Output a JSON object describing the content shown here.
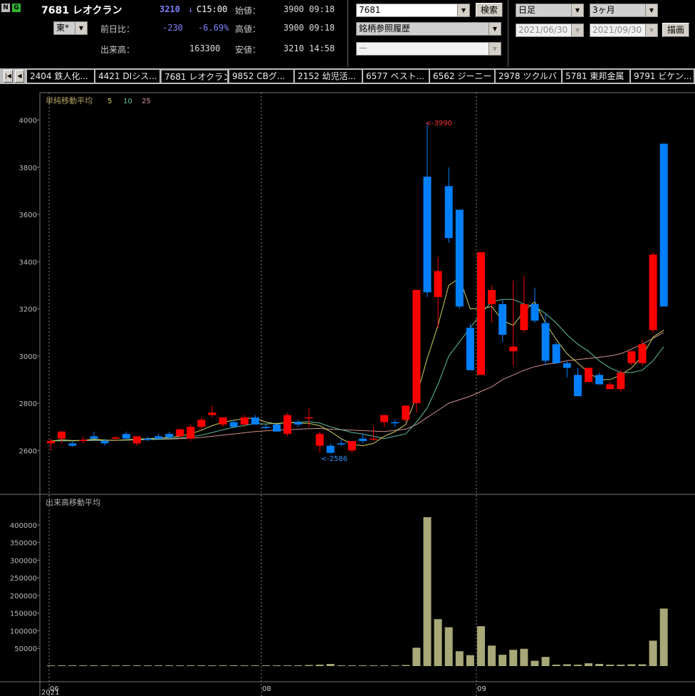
{
  "header": {
    "badge_n": "N",
    "badge_g": "G",
    "stock_title": "7681 レオクラン",
    "current_price": "3210",
    "price_arrow": "↓",
    "price_time": "C15:00",
    "market_select": "東*",
    "change_label": "前日比：",
    "change_value": "-230",
    "change_pct": "-6.69%",
    "volume_label": "出来高：",
    "volume_value": "163300",
    "open_label": "始値：",
    "open_value": "3900",
    "open_time": "09:18",
    "high_label": "高値：",
    "high_value": "3900",
    "high_time": "09:18",
    "low_label": "安値：",
    "low_value": "3210",
    "low_time": "14:58",
    "code_input": "7681",
    "search_button": "検索",
    "history_select": "銘柄参照履歴",
    "blank_select": "ー",
    "period_select": "日足",
    "range_select": "3ヶ月",
    "date_from": "2021/06/30",
    "date_to": "2021/09/30",
    "draw_button": "描画"
  },
  "tabs": [
    "2404 鉄人化...",
    "4421 DIシス...",
    "7681 レオクラン",
    "9852 CBグ...",
    "2152 幼児活...",
    "6577 ベスト...",
    "6562 ジーニー",
    "2978 ツクルバ",
    "5781 東邦金属",
    "9791 ビケン..."
  ],
  "colors": {
    "up": "#ff0000",
    "down": "#0080ff",
    "ma5": "#d0d060",
    "ma10": "#60c0a0",
    "ma25": "#d09090",
    "volume": "#a8a878"
  },
  "chart_data": {
    "type": "candlestick",
    "price_title": "単純移動平均",
    "ma_periods": [
      "5",
      "10",
      "25"
    ],
    "volume_title": "出来高移動平均",
    "price_ylim": [
      2450,
      4080
    ],
    "price_ticks": [
      "4000",
      "3800",
      "3600",
      "3400",
      "3200",
      "3000",
      "2800",
      "2600"
    ],
    "volume_ylim": [
      0,
      440000
    ],
    "volume_ticks": [
      "400000",
      "350000",
      "300000",
      "250000",
      "200000",
      "150000",
      "100000",
      "50000"
    ],
    "x_month_labels": [
      "06",
      "08",
      "09"
    ],
    "x_year_label": "2021",
    "annotations": {
      "high": "<-3990",
      "low": "<-2586"
    },
    "ohlc": [
      [
        2630,
        2650,
        2600,
        2640
      ],
      [
        2650,
        2680,
        2630,
        2680
      ],
      [
        2630,
        2640,
        2615,
        2620
      ],
      [
        2640,
        2660,
        2630,
        2645
      ],
      [
        2660,
        2680,
        2650,
        2650
      ],
      [
        2640,
        2650,
        2620,
        2630
      ],
      [
        2650,
        2660,
        2640,
        2655
      ],
      [
        2670,
        2680,
        2650,
        2650
      ],
      [
        2630,
        2660,
        2620,
        2660
      ],
      [
        2650,
        2660,
        2640,
        2645
      ],
      [
        2660,
        2670,
        2650,
        2650
      ],
      [
        2670,
        2680,
        2650,
        2655
      ],
      [
        2660,
        2690,
        2650,
        2690
      ],
      [
        2650,
        2710,
        2640,
        2700
      ],
      [
        2700,
        2740,
        2690,
        2730
      ],
      [
        2750,
        2790,
        2740,
        2760
      ],
      [
        2710,
        2740,
        2700,
        2740
      ],
      [
        2720,
        2730,
        2700,
        2700
      ],
      [
        2710,
        2750,
        2700,
        2740
      ],
      [
        2740,
        2750,
        2710,
        2710
      ],
      [
        2700,
        2710,
        2690,
        2695
      ],
      [
        2710,
        2710,
        2680,
        2680
      ],
      [
        2670,
        2760,
        2660,
        2750
      ],
      [
        2720,
        2730,
        2700,
        2710
      ],
      [
        2740,
        2780,
        2700,
        2740
      ],
      [
        2620,
        2680,
        2590,
        2670
      ],
      [
        2620,
        2630,
        2586,
        2590
      ],
      [
        2630,
        2650,
        2620,
        2625
      ],
      [
        2600,
        2640,
        2590,
        2640
      ],
      [
        2650,
        2670,
        2630,
        2640
      ],
      [
        2650,
        2700,
        2640,
        2650
      ],
      [
        2720,
        2740,
        2700,
        2750
      ],
      [
        2720,
        2730,
        2700,
        2715
      ],
      [
        2730,
        2790,
        2720,
        2790
      ],
      [
        2800,
        3280,
        2760,
        3280
      ],
      [
        3760,
        3990,
        3250,
        3270
      ],
      [
        3250,
        3420,
        3120,
        3360
      ],
      [
        3720,
        3800,
        3480,
        3500
      ],
      [
        3620,
        3620,
        3200,
        3210
      ],
      [
        3120,
        3140,
        2940,
        2940
      ],
      [
        2920,
        3440,
        2920,
        3440
      ],
      [
        3220,
        3300,
        3140,
        3280
      ],
      [
        3220,
        3240,
        3060,
        3090
      ],
      [
        3020,
        3320,
        2960,
        3040
      ],
      [
        3110,
        3340,
        3100,
        3220
      ],
      [
        3220,
        3290,
        3140,
        3150
      ],
      [
        3140,
        3180,
        2960,
        2980
      ],
      [
        3050,
        3060,
        2970,
        2970
      ],
      [
        2970,
        2980,
        2910,
        2950
      ],
      [
        2920,
        2950,
        2830,
        2830
      ],
      [
        2890,
        2950,
        2890,
        2950
      ],
      [
        2920,
        2930,
        2880,
        2880
      ],
      [
        2860,
        2890,
        2860,
        2880
      ],
      [
        2860,
        2940,
        2850,
        2930
      ],
      [
        2970,
        3020,
        2960,
        3020
      ],
      [
        2970,
        3070,
        2960,
        3050
      ],
      [
        3110,
        3440,
        3100,
        3430
      ],
      [
        3900,
        3900,
        3210,
        3210
      ]
    ],
    "volume": [
      2000,
      2000,
      2000,
      2000,
      2000,
      2000,
      2000,
      2000,
      2000,
      2000,
      2000,
      2000,
      2000,
      2000,
      2000,
      2000,
      2000,
      2000,
      2000,
      2000,
      2000,
      2000,
      2000,
      2000,
      3000,
      4000,
      6000,
      2000,
      2000,
      2000,
      2000,
      2000,
      2000,
      3000,
      52000,
      422000,
      133000,
      110000,
      42000,
      31000,
      113000,
      58000,
      32000,
      46000,
      49000,
      15000,
      26000,
      4000,
      5000,
      4000,
      8000,
      6000,
      4000,
      4000,
      5000,
      5000,
      72000,
      163000
    ],
    "ma_points": {
      "ma5": [
        2640,
        2645,
        2642,
        2643,
        2648,
        2644,
        2643,
        2645,
        2648,
        2650,
        2652,
        2655,
        2660,
        2670,
        2686,
        2705,
        2720,
        2728,
        2735,
        2738,
        2720,
        2712,
        2720,
        2715,
        2715,
        2705,
        2680,
        2650,
        2625,
        2620,
        2630,
        2660,
        2680,
        2710,
        2830,
        2990,
        3130,
        3300,
        3330,
        3200,
        3200,
        3210,
        3150,
        3130,
        3190,
        3230,
        3140,
        3070,
        3010,
        2970,
        2930,
        2900,
        2900,
        2920,
        2950,
        3000,
        3080,
        3110
      ],
      "ma10": [
        2640,
        2642,
        2641,
        2642,
        2644,
        2643,
        2643,
        2644,
        2645,
        2647,
        2648,
        2650,
        2653,
        2658,
        2665,
        2676,
        2688,
        2698,
        2706,
        2714,
        2712,
        2715,
        2718,
        2720,
        2722,
        2716,
        2700,
        2688,
        2676,
        2670,
        2660,
        2650,
        2660,
        2670,
        2720,
        2780,
        2880,
        3000,
        3060,
        3120,
        3180,
        3230,
        3240,
        3240,
        3220,
        3210,
        3180,
        3140,
        3090,
        3050,
        3020,
        2980,
        2950,
        2930,
        2930,
        2940,
        2980,
        3040
      ],
      "ma25": [
        2640,
        2641,
        2641,
        2642,
        2642,
        2643,
        2643,
        2644,
        2645,
        2646,
        2647,
        2648,
        2650,
        2652,
        2655,
        2660,
        2665,
        2670,
        2675,
        2680,
        2683,
        2686,
        2688,
        2690,
        2692,
        2693,
        2690,
        2688,
        2686,
        2684,
        2682,
        2680,
        2685,
        2690,
        2710,
        2740,
        2770,
        2800,
        2815,
        2830,
        2850,
        2870,
        2900,
        2920,
        2940,
        2955,
        2965,
        2970,
        2980,
        2985,
        2990,
        2995,
        3000,
        3010,
        3030,
        3050,
        3075,
        3100
      ]
    }
  }
}
